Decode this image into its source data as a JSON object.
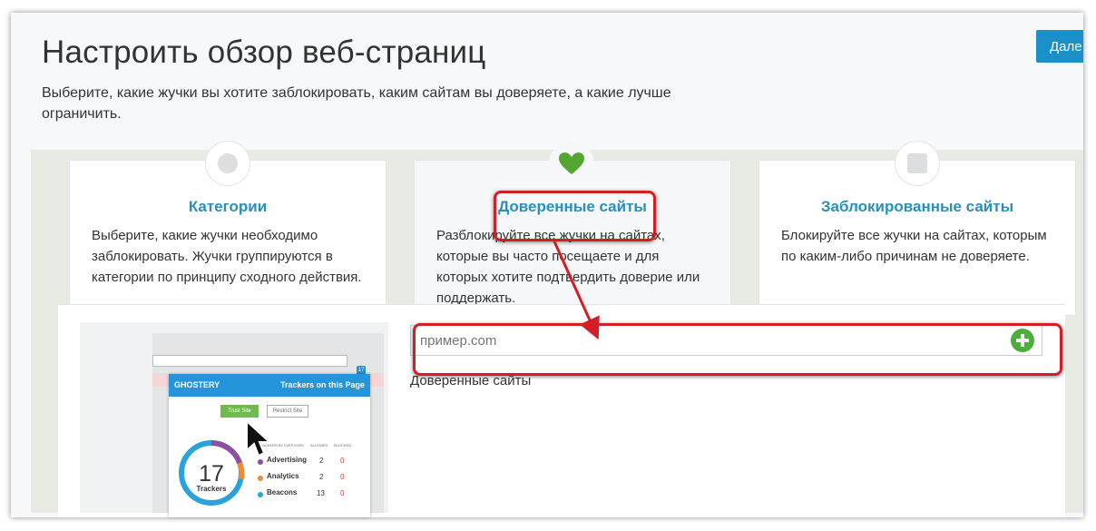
{
  "header": {
    "title": "Настроить обзор веб-страниц",
    "subtitle": "Выберите, какие жучки вы хотите заблокировать, каким сайтам вы доверяете, а какие лучше ограничить.",
    "next_label": "Дале"
  },
  "panels": [
    {
      "icon": "circle-icon",
      "title": "Категории",
      "description": "Выберите, какие жучки необходимо заблокировать. Жучки группируются в категории по принципу сходного действия."
    },
    {
      "icon": "heart-icon",
      "title": "Доверенные сайты",
      "description": "Разблокируйте все жучки на сайтах, которые вы часто посещаете и для которых хотите подтвердить доверие или поддержать."
    },
    {
      "icon": "square-icon",
      "title": "Заблокированные сайты",
      "description": "Блокируйте все жучки на сайтах, которым по каким-либо причинам не доверяете."
    }
  ],
  "trusted_sites": {
    "input_placeholder": "пример.com",
    "list_label": "Доверенные сайты"
  },
  "illustration": {
    "brand": "GHOSTERY",
    "header_right": "Trackers on this Page",
    "trust_button": "Trust Site",
    "restrict_button": "Restrict Site",
    "col_category": "TRACKERS BY CATEGORY",
    "col_allowed": "ALLOWED",
    "col_blocked": "BLOCKED",
    "tracker_count": "17",
    "tracker_label": "Trackers",
    "badge": "17",
    "rows": [
      {
        "name": "Advertising",
        "allowed": "2",
        "blocked": "0",
        "color": "#8e4fa3"
      },
      {
        "name": "Analytics",
        "allowed": "2",
        "blocked": "0",
        "color": "#ee8a30"
      },
      {
        "name": "Beacons",
        "allowed": "13",
        "blocked": "0",
        "color": "#2aa3dd"
      }
    ]
  },
  "colors": {
    "accent": "#2a8fbd",
    "highlight": "#d41e25",
    "add_button": "#4caf3c",
    "heart": "#55a630"
  }
}
